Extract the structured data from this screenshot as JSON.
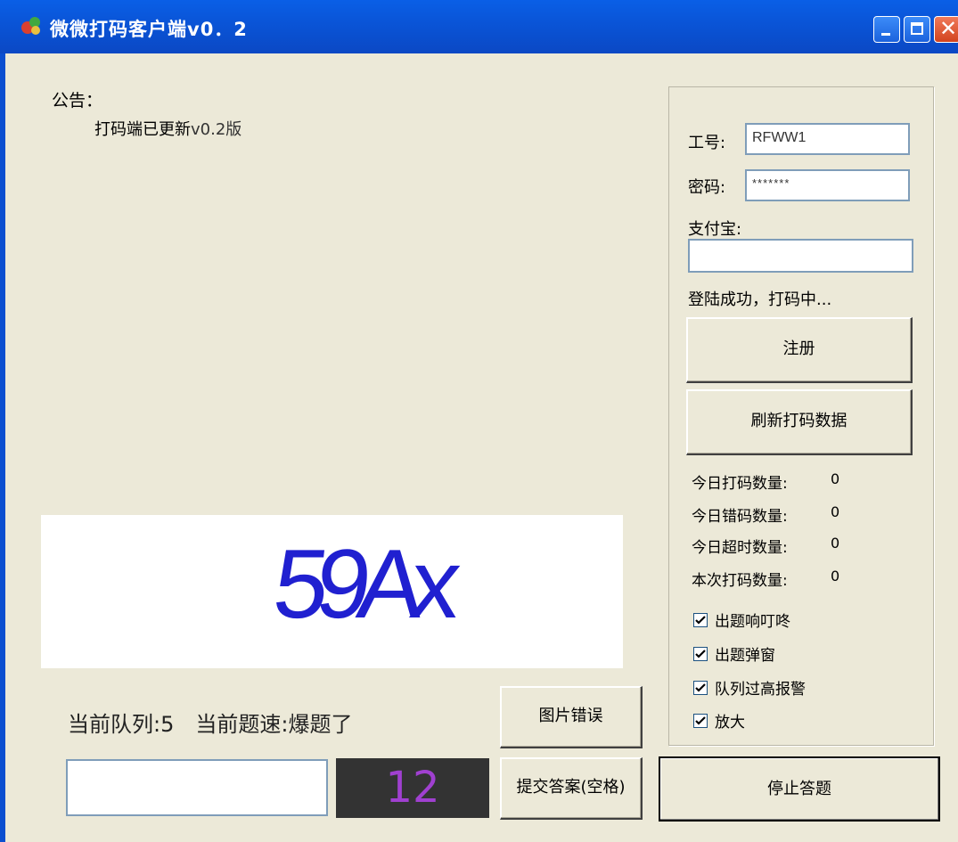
{
  "window": {
    "title": "微微打码客户端v0．2",
    "close_glyph": "✕"
  },
  "notice": {
    "heading": "公告：",
    "text": "打码端已更新",
    "version": "v0.2版"
  },
  "captcha": {
    "text": "59Ax"
  },
  "queue": {
    "text": "当前队列:5　当前题速:爆题了"
  },
  "answer": {
    "value": "",
    "countdown": "12"
  },
  "buttons": {
    "image_error": "图片错误",
    "submit": "提交答案(空格)",
    "stop": "停止答题",
    "register": "注册",
    "refresh": "刷新打码数据"
  },
  "login": {
    "id_label": "工号:",
    "id_value": "RFWW1",
    "pw_label": "密码:",
    "pw_value": "*******",
    "alipay_label": "支付宝:",
    "alipay_value": "",
    "status": "登陆成功，打码中..."
  },
  "stats": [
    {
      "label": "今日打码数量:",
      "value": "0"
    },
    {
      "label": "今日错码数量:",
      "value": "0"
    },
    {
      "label": "今日超时数量:",
      "value": "0"
    },
    {
      "label": "本次打码数量:",
      "value": "0"
    }
  ],
  "options": [
    {
      "label": "出题响叮咚",
      "checked": true
    },
    {
      "label": "出题弹窗",
      "checked": true
    },
    {
      "label": "队列过高报警",
      "checked": true
    },
    {
      "label": "放大",
      "checked": true
    }
  ],
  "colors": {
    "captcha_text": "#2020d0",
    "countdown_text": "#a040d0",
    "title_bar": "#0a55d8"
  }
}
